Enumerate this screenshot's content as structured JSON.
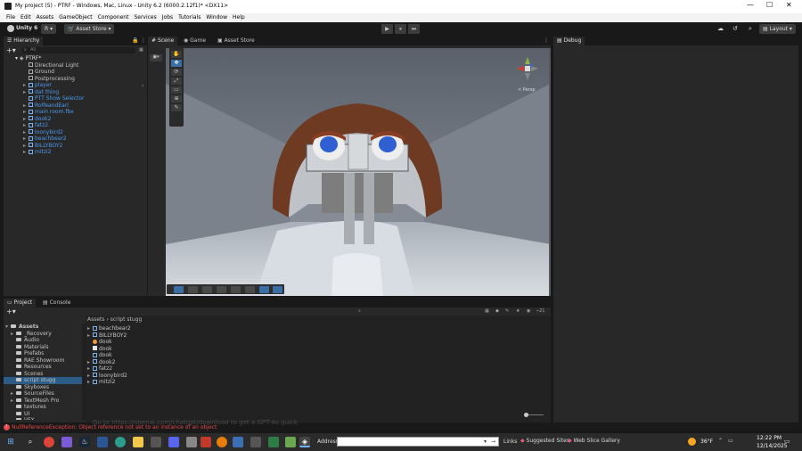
{
  "window": {
    "title": "My project (5) - PTRF - Windows, Mac, Linux - Unity 6.2 (6000.2.12f1)* <DX11>",
    "minimize": "—",
    "maximize": "☐",
    "close": "✕"
  },
  "menu": [
    "File",
    "Edit",
    "Assets",
    "GameObject",
    "Component",
    "Services",
    "Jobs",
    "Tutorials",
    "Window",
    "Help"
  ],
  "toolbar": {
    "account": "Unity 6",
    "user": "R",
    "asset_store": "Asset Store",
    "layout": "Layout",
    "play": "▶",
    "pause": "⏸",
    "step": "⏭"
  },
  "hierarchy": {
    "tab": "Hierarchy",
    "search_placeholder": "All",
    "scene": "PTRF*",
    "items": [
      {
        "label": "Directional Light",
        "type": "plain"
      },
      {
        "label": "Ground",
        "type": "plain"
      },
      {
        "label": "Postprocessing",
        "type": "plain"
      },
      {
        "label": "player",
        "type": "prefab",
        "arrow": "▸"
      },
      {
        "label": "dat thing",
        "type": "prefab",
        "arrow": "▸"
      },
      {
        "label": "PTT Show Selector",
        "type": "prefab",
        "arrow": ""
      },
      {
        "label": "RolfeandEarl",
        "type": "prefab",
        "arrow": "▸"
      },
      {
        "label": "main room.fbx",
        "type": "prefab",
        "arrow": "▸"
      },
      {
        "label": "dook2",
        "type": "prefab",
        "arrow": "▸"
      },
      {
        "label": "fatz2",
        "type": "prefab",
        "arrow": "▸"
      },
      {
        "label": "loonybird2",
        "type": "prefab",
        "arrow": "▸"
      },
      {
        "label": "beachbear2",
        "type": "prefab",
        "arrow": "▸"
      },
      {
        "label": "BILLYBOY2",
        "type": "prefab",
        "arrow": "▸"
      },
      {
        "label": "mitzi2",
        "type": "prefab",
        "arrow": "▸"
      }
    ]
  },
  "scene_view": {
    "tabs": [
      "Scene",
      "Game",
      "Asset Store"
    ],
    "persp": "< Persp"
  },
  "debug_tab": "Debug",
  "project": {
    "tabs": [
      "Project",
      "Console"
    ],
    "breadcrumb": [
      "Assets",
      "script stugg"
    ],
    "badge": "21",
    "folders": [
      {
        "label": "Assets",
        "level": 0,
        "arrow": "▾"
      },
      {
        "label": "_Recovery",
        "level": 1,
        "arrow": "▸"
      },
      {
        "label": "Audio",
        "level": 1,
        "arrow": ""
      },
      {
        "label": "Materials",
        "level": 1,
        "arrow": ""
      },
      {
        "label": "Prefabs",
        "level": 1,
        "arrow": ""
      },
      {
        "label": "RAE Showroom",
        "level": 1,
        "arrow": ""
      },
      {
        "label": "Resources",
        "level": 1,
        "arrow": ""
      },
      {
        "label": "Scenes",
        "level": 1,
        "arrow": ""
      },
      {
        "label": "script stugg",
        "level": 1,
        "arrow": ""
      },
      {
        "label": "Skyboxes",
        "level": 1,
        "arrow": ""
      },
      {
        "label": "SourceFiles",
        "level": 1,
        "arrow": "▸"
      },
      {
        "label": "TextMesh Pro",
        "level": 1,
        "arrow": "▸"
      },
      {
        "label": "textures",
        "level": 1,
        "arrow": ""
      },
      {
        "label": "UI",
        "level": 1,
        "arrow": ""
      },
      {
        "label": "VFX",
        "level": 1,
        "arrow": ""
      }
    ],
    "files": [
      {
        "label": "beachbear2",
        "icon": "prefab",
        "arrow": "▸"
      },
      {
        "label": "BILLYBOY2",
        "icon": "prefab",
        "arrow": "▸"
      },
      {
        "label": "dook",
        "icon": "script",
        "arrow": ""
      },
      {
        "label": "dook",
        "icon": "doc",
        "arrow": ""
      },
      {
        "label": "dook",
        "icon": "prefab",
        "arrow": ""
      },
      {
        "label": "dook2",
        "icon": "prefab",
        "arrow": "▸"
      },
      {
        "label": "fatz2",
        "icon": "prefab",
        "arrow": "▸"
      },
      {
        "label": "loonybird2",
        "icon": "prefab",
        "arrow": "▸"
      },
      {
        "label": "mitzi2",
        "icon": "prefab",
        "arrow": "▸"
      }
    ]
  },
  "status": {
    "error": "NullReferenceException: Object reference not set to an instance of an object",
    "behind": "Go to https://openai.com/chatgpt/download to get a GPT-4o quick"
  },
  "taskbar": {
    "address_label": "Address",
    "links": "Links",
    "suggested_sites": "Suggested Sites",
    "web_slice": "Web Slice Gallery",
    "weather": "36°F",
    "time": "12:22 PM",
    "date": "12/14/2025"
  },
  "colors": {
    "accent_blue": "#4d9af0",
    "selection": "#2c5d87",
    "error_red": "#e64848"
  }
}
